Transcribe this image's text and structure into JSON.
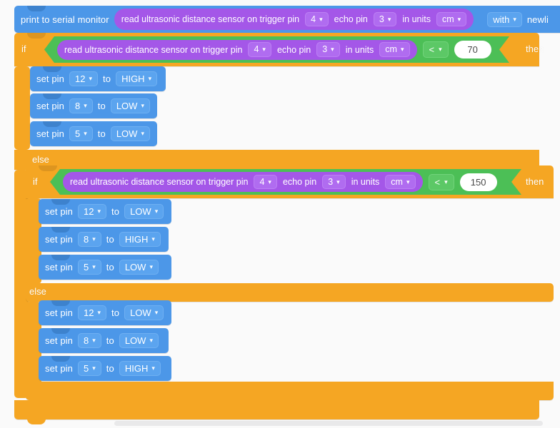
{
  "workspace": {
    "background_color": "#fafafa",
    "colors": {
      "statement_blue": "#4c97e8",
      "reporter_purple": "#a457e8",
      "boolean_green": "#4cbf56",
      "control_orange": "#f5a623",
      "number_field_white": "#ffffff"
    }
  },
  "blocks": {
    "print_serial": {
      "label": "print to serial monitor",
      "with_label": "with",
      "with_value": "▾",
      "newline_label": "newli"
    },
    "sensor": {
      "label": "read ultrasonic distance sensor on trigger pin",
      "trigger_pin": "4",
      "echo_pin_label": "echo pin",
      "echo_pin": "3",
      "units_label": "in units",
      "units": "cm",
      "caret": "▾"
    },
    "if_outer": {
      "if_label": "if",
      "then_label": "then",
      "else_label": "else",
      "operator": "<",
      "compare_value": "70"
    },
    "if_inner": {
      "if_label": "if",
      "then_label": "then",
      "else_label": "else",
      "operator": "<",
      "compare_value": "150"
    },
    "set_pin_label": "set pin",
    "to_label": "to",
    "caret": "▾",
    "branch_outer_then": [
      {
        "pin": "12",
        "state": "HIGH"
      },
      {
        "pin": "8",
        "state": "LOW"
      },
      {
        "pin": "5",
        "state": "LOW"
      }
    ],
    "branch_inner_then": [
      {
        "pin": "12",
        "state": "LOW"
      },
      {
        "pin": "8",
        "state": "HIGH"
      },
      {
        "pin": "5",
        "state": "LOW"
      }
    ],
    "branch_inner_else": [
      {
        "pin": "12",
        "state": "LOW"
      },
      {
        "pin": "8",
        "state": "LOW"
      },
      {
        "pin": "5",
        "state": "HIGH"
      }
    ]
  }
}
